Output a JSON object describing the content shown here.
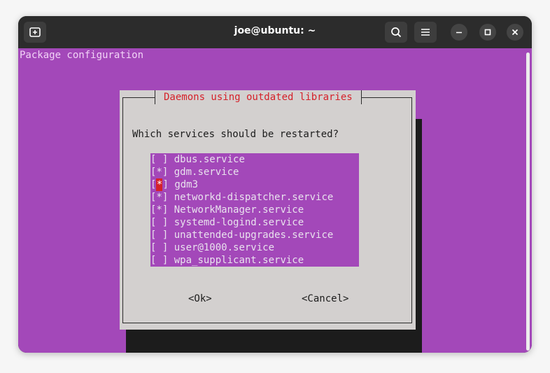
{
  "window": {
    "title": "joe@ubuntu: ~"
  },
  "terminal": {
    "header": "Package configuration"
  },
  "dialog": {
    "title": "Daemons using outdated libraries",
    "question": "Which services should be restarted?",
    "items": [
      {
        "label": "dbus.service",
        "checked": false,
        "box": "[ ]"
      },
      {
        "label": "gdm.service",
        "checked": true,
        "box": "[*]"
      },
      {
        "label": "gdm3",
        "checked": true,
        "box": "[*]",
        "focused": true
      },
      {
        "label": "networkd-dispatcher.service",
        "checked": true,
        "box": "[*]"
      },
      {
        "label": "NetworkManager.service",
        "checked": true,
        "box": "[*]"
      },
      {
        "label": "systemd-logind.service",
        "checked": false,
        "box": "[ ]"
      },
      {
        "label": "unattended-upgrades.service",
        "checked": false,
        "box": "[ ]"
      },
      {
        "label": "user@1000.service",
        "checked": false,
        "box": "[ ]"
      },
      {
        "label": "wpa_supplicant.service",
        "checked": false,
        "box": "[ ]"
      }
    ],
    "ok_label": "<Ok>",
    "cancel_label": "<Cancel>"
  },
  "icons": {
    "new_tab": "new-tab-icon",
    "search": "search-icon",
    "menu": "hamburger-menu-icon",
    "minimize": "minimize-icon",
    "maximize": "maximize-icon",
    "close": "close-icon"
  },
  "colors": {
    "terminal_bg": "#a348b9",
    "dialog_bg": "#d3d0cf",
    "title_red": "#d5212a",
    "titlebar": "#2c2c2c"
  }
}
